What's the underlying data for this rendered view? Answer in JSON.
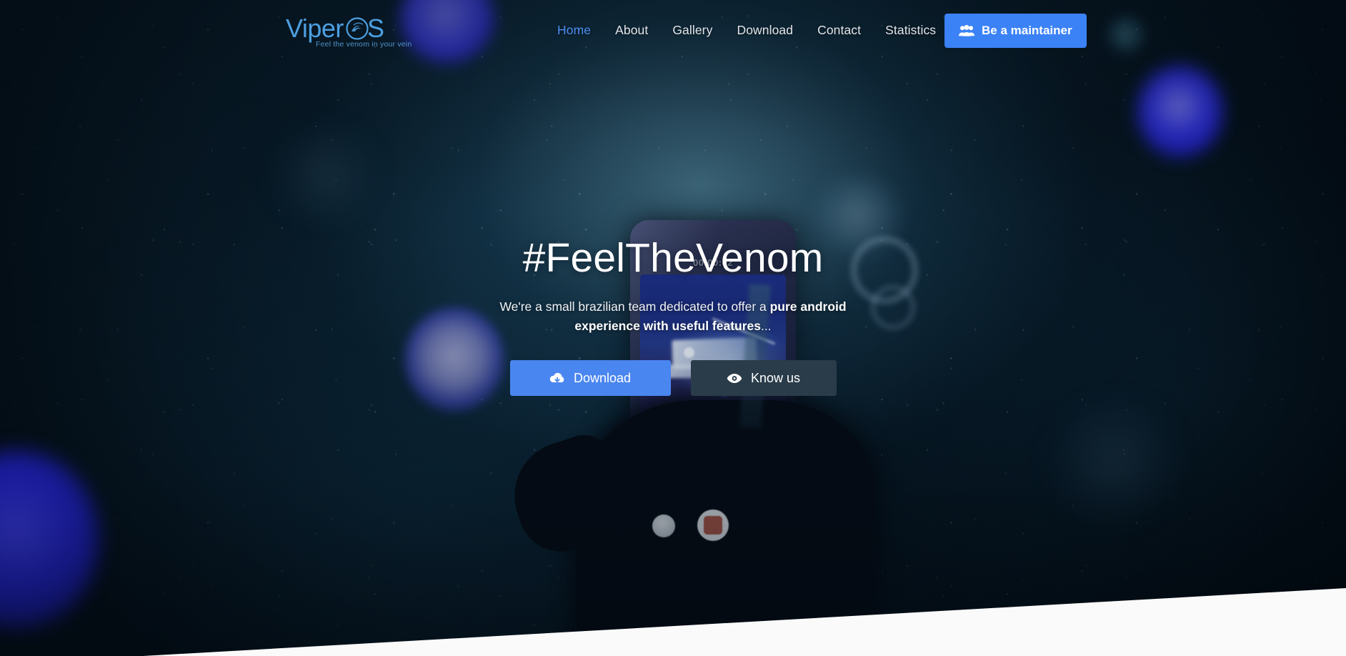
{
  "brand": {
    "name": "ViperOS",
    "name_part_1": "Viper",
    "name_part_2": "S",
    "tagline": "Feel the venom in your vein",
    "logo_icon": "viper-circle-icon",
    "color": "#4d9fe0"
  },
  "nav": {
    "items": [
      {
        "label": "Home",
        "active": true
      },
      {
        "label": "About",
        "active": false
      },
      {
        "label": "Gallery",
        "active": false
      },
      {
        "label": "Download",
        "active": false
      },
      {
        "label": "Contact",
        "active": false
      },
      {
        "label": "Statistics",
        "active": false
      }
    ],
    "active_color": "#4d8ff5",
    "link_color": "#e2e6ea",
    "cta": {
      "label": "Be a maintainer",
      "icon": "users-icon",
      "background": "#3b82f6",
      "text_color": "#ffffff"
    }
  },
  "hero": {
    "title": "#FeelTheVenom",
    "subtitle_lead": "We're a small brazilian team dedicated to offer a ",
    "subtitle_strong": "pure android experience with useful features",
    "subtitle_tail": "...",
    "buttons": [
      {
        "label": "Download",
        "icon": "cloud-download-icon",
        "background": "#4a86f0",
        "text_color": "#ffffff"
      },
      {
        "label": "Know us",
        "icon": "eye-icon",
        "background": "#2a3c49",
        "text_color": "#ffffff"
      }
    ]
  },
  "background": {
    "scene": "night-sky-hand-holding-phone",
    "phone_timer": "00:00:02",
    "base_color": "#081b28",
    "accent_bokeh_color": "#2222cf",
    "wedge_color": "#fafafa"
  }
}
